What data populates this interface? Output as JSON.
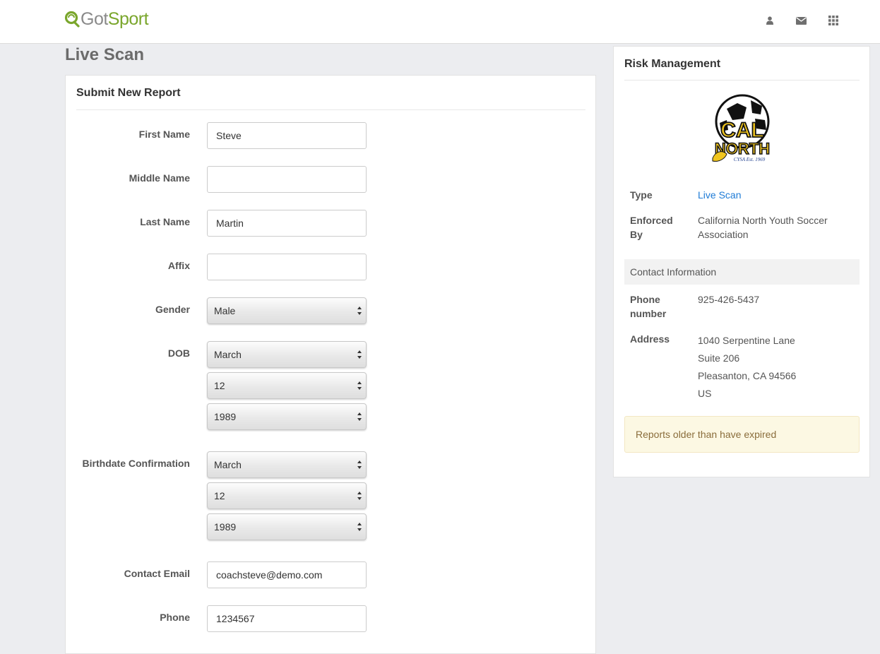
{
  "header": {
    "logo_text_got": "Got",
    "logo_text_sport": "Sport",
    "icons": [
      "user-icon",
      "envelope-icon",
      "apps-grid-icon"
    ]
  },
  "page": {
    "title": "Live Scan"
  },
  "form": {
    "heading": "Submit New Report",
    "fields": {
      "first_name": {
        "label": "First Name",
        "value": "Steve"
      },
      "middle_name": {
        "label": "Middle Name",
        "value": ""
      },
      "last_name": {
        "label": "Last Name",
        "value": "Martin"
      },
      "affix": {
        "label": "Affix",
        "value": ""
      },
      "gender": {
        "label": "Gender",
        "value": "Male"
      },
      "dob": {
        "label": "DOB",
        "month": "March",
        "day": "12",
        "year": "1989"
      },
      "birthdate_confirmation": {
        "label": "Birthdate Confirmation",
        "month": "March",
        "day": "12",
        "year": "1989"
      },
      "contact_email": {
        "label": "Contact Email",
        "value": "coachsteve@demo.com"
      },
      "phone": {
        "label": "Phone",
        "value": "1234567"
      }
    }
  },
  "risk_management": {
    "heading": "Risk Management",
    "crest_text": {
      "top": "CAL",
      "bottom": "NORTH",
      "sub": "CYSA Est. 1969"
    },
    "type": {
      "term": "Type",
      "value": "Live Scan"
    },
    "enforced_by": {
      "term_line1": "Enforced",
      "term_line2": "By",
      "value_line1": "California North Youth Soccer",
      "value_line2": "Association"
    },
    "contact_section": "Contact Information",
    "phone": {
      "term_line1": "Phone",
      "term_line2": "number",
      "value": "925-426-5437"
    },
    "address": {
      "term": "Address",
      "line1": "1040 Serpentine Lane",
      "line2": "Suite 206",
      "line3": "Pleasanton, CA 94566",
      "line4": "US"
    },
    "notice": "Reports older than have expired"
  },
  "colors": {
    "brand_green": "#7aa62c",
    "link_blue": "#1e7bd6",
    "notice_bg": "#fcf8e3",
    "page_bg": "#ecedf0"
  }
}
